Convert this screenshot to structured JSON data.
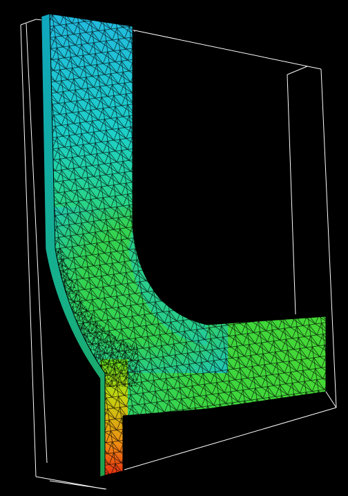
{
  "viewer": {
    "background": "#000000",
    "bounding_box_color": "#ffffff",
    "mesh_edge_color": "#000000",
    "colormap": "jet",
    "stops": [
      {
        "t": 0.0,
        "color": "#16d3e6"
      },
      {
        "t": 0.35,
        "color": "#26c9b4"
      },
      {
        "t": 0.55,
        "color": "#30d83a"
      },
      {
        "t": 0.7,
        "color": "#6fe01a"
      },
      {
        "t": 0.82,
        "color": "#c8d616"
      },
      {
        "t": 0.92,
        "color": "#f08a10"
      },
      {
        "t": 1.0,
        "color": "#e82412"
      }
    ]
  }
}
